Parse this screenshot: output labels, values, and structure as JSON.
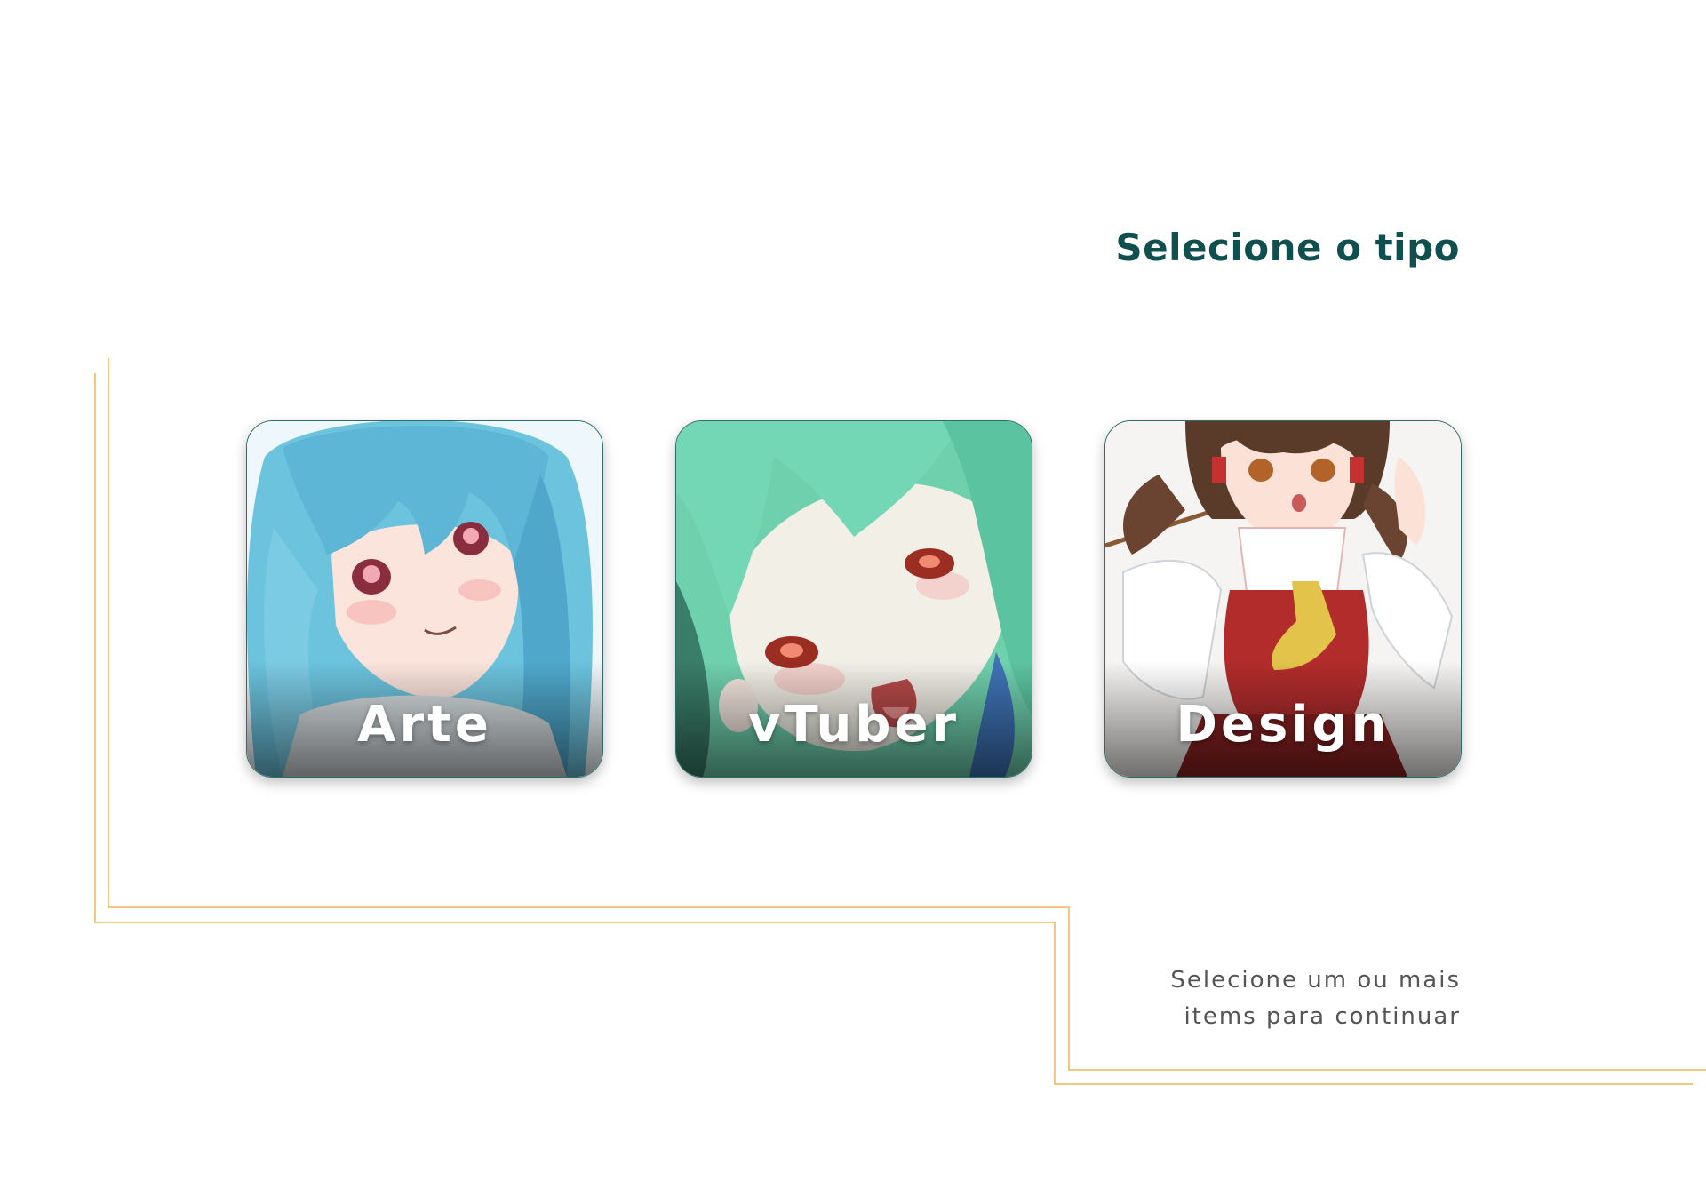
{
  "header": {
    "title": "Selecione o tipo"
  },
  "cards": [
    {
      "label": "Arte",
      "icon": "anime-girl-blue-hair-image"
    },
    {
      "label": "vTuber",
      "icon": "anime-girl-green-hair-image"
    },
    {
      "label": "Design",
      "icon": "anime-girl-brown-hair-image"
    }
  ],
  "footer": {
    "hint_line1": "Selecione um ou mais",
    "hint_line2": "items para continuar"
  },
  "colors": {
    "title": "#0f4f4e",
    "accent_lines": "#f5c77e",
    "card_border": "#2f6b6a",
    "hint_text": "#555555"
  }
}
